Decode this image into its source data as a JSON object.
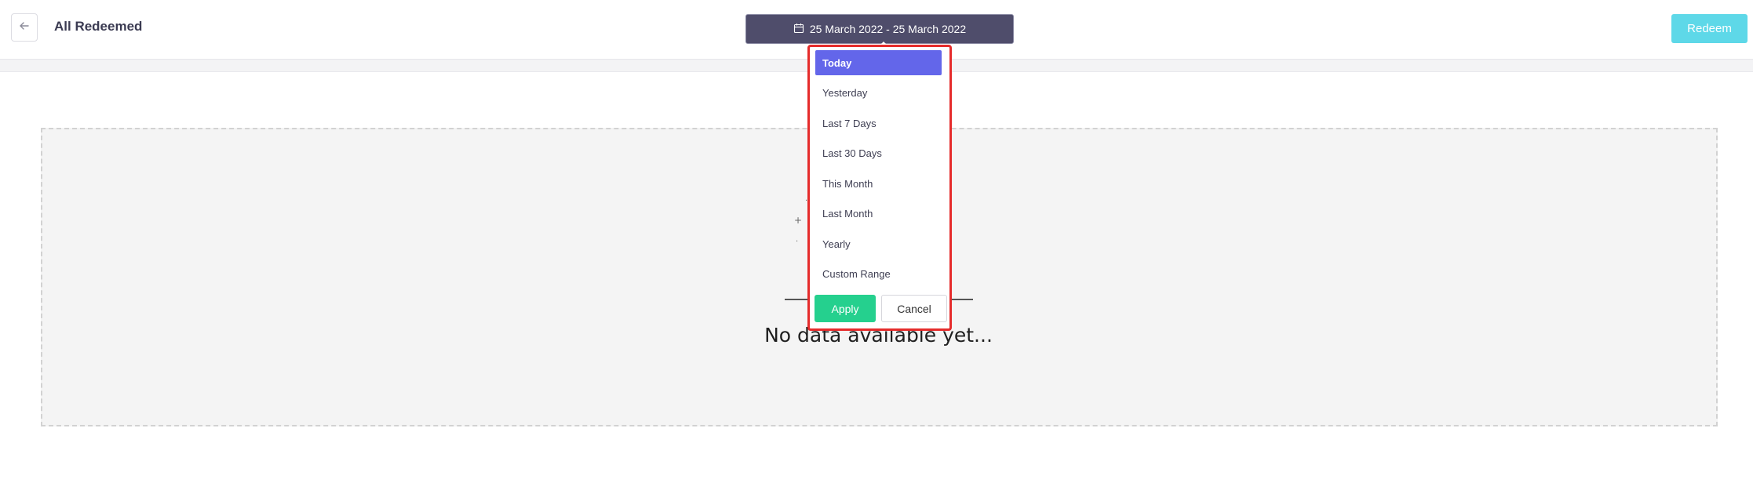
{
  "header": {
    "title": "All Redeemed",
    "back_icon": "arrow-left-icon",
    "date_range_label": "25 March 2022 - 25 March 2022",
    "calendar_icon": "calendar-icon",
    "redeem_label": "Redeem"
  },
  "date_picker": {
    "ranges": [
      {
        "label": "Today",
        "selected": true
      },
      {
        "label": "Yesterday",
        "selected": false
      },
      {
        "label": "Last 7 Days",
        "selected": false
      },
      {
        "label": "Last 30 Days",
        "selected": false
      },
      {
        "label": "This Month",
        "selected": false
      },
      {
        "label": "Last Month",
        "selected": false
      },
      {
        "label": "Yearly",
        "selected": false
      },
      {
        "label": "Custom Range",
        "selected": false
      }
    ],
    "apply_label": "Apply",
    "cancel_label": "Cancel"
  },
  "empty_state": {
    "message": "No data available yet..."
  },
  "colors": {
    "date_button_bg": "#4f4d6b",
    "redeem_bg": "#5ed8e8",
    "selected_range_bg": "#6366ea",
    "apply_bg": "#25d08e",
    "dropdown_highlight_border": "#e52b2b"
  }
}
